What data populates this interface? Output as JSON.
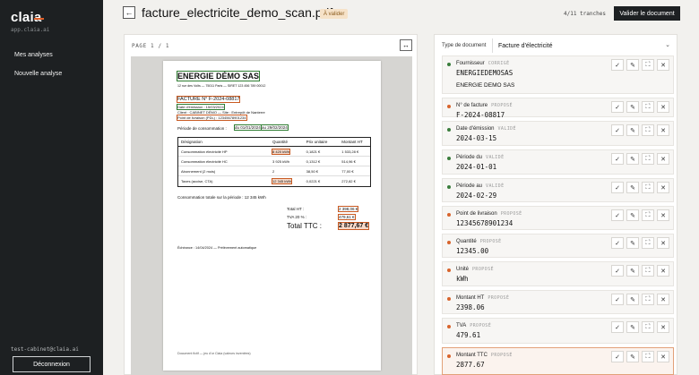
{
  "app": {
    "logo": "claia",
    "domain": "app.claia.ai",
    "accent": "#e2612b"
  },
  "sidebar": {
    "items": [
      {
        "label": "Mes analyses"
      },
      {
        "label": "Nouvelle analyse"
      }
    ],
    "user_email": "test-cabinet@claia.ai",
    "logout_label": "Déconnexion"
  },
  "header": {
    "back_icon": "arrow-left-icon",
    "title": "facture_electricite_demo_scan.pdf",
    "status": "À valider",
    "slice_count": "4/11 tranches",
    "validate_label": "Valider le document"
  },
  "viewer": {
    "page_indicator": "PAGE 1 / 1",
    "expand_icon": "expand-horizontal-icon",
    "pdf": {
      "company": "ENERGIE DÉMO SAS",
      "address": "12 rue des Volts — 75011 Paris — SIRET 123 456 789 00012",
      "invoice_no": "FACTURE N° F-2024-08817",
      "issue_date": "Date d'émission : 15/03/2024",
      "client": "Client : CABINET DÉMO — Site : Entrepôt de Nanterre",
      "delivery_point": "Point de livraison (PDL) : 12345678901234",
      "period_label": "Période de consommation :",
      "period_from": "du 01/01/2024",
      "period_to": "au 29/02/2024",
      "table_headers": [
        "Désignation",
        "Quantité",
        "Prix unitaire",
        "Montant HT"
      ],
      "table_rows": [
        [
          "Consommation électricité HP",
          "8 420 kWh",
          "0,1821 €",
          "1 533,28 €"
        ],
        [
          "Consommation électricité HC",
          "3 925 kWh",
          "0,1312 €",
          "514,96 €"
        ],
        [
          "Abonnement (2 mois)",
          "2",
          "38,50 €",
          "77,00 €"
        ],
        [
          "Taxes (accise, CTA)",
          "12 345 kWh",
          "0,0221 €",
          "272,82 €"
        ]
      ],
      "total_consumption": "Consommation totale sur la période : 12 345 kWh",
      "total_ht_label": "Total HT :",
      "total_ht": "2 398,06 €",
      "tva_label": "TVA 20 % :",
      "tva": "479,61 €",
      "total_ttc_label": "Total TTC :",
      "total_ttc": "2 877,67 €",
      "due": "Échéance : 14/04/2024 — Prélèvement automatique",
      "footer": "Document fictif — jeu d'or Claia (valeurs inventées)"
    }
  },
  "panel": {
    "doc_type_label": "Type de document",
    "doc_type_value": "Facture d'électricité",
    "fields": [
      {
        "name": "Fournisseur",
        "state": "CORRIGÉ",
        "value": "ENERGIEDEMOSAS",
        "value2": "ENERGIE DEMO SAS",
        "color": "#3a7d3c"
      },
      {
        "name": "N° de facture",
        "state": "PROPOSÉ",
        "value": "F-2024-08817",
        "color": "#d8642c"
      },
      {
        "name": "Date d'émission",
        "state": "VALIDÉ",
        "value": "2024-03-15",
        "color": "#3a7d3c"
      },
      {
        "name": "Période du",
        "state": "VALIDÉ",
        "value": "2024-01-01",
        "color": "#3a7d3c"
      },
      {
        "name": "Période au",
        "state": "VALIDÉ",
        "value": "2024-02-29",
        "color": "#3a7d3c"
      },
      {
        "name": "Point de livraison",
        "state": "PROPOSÉ",
        "value": "12345678901234",
        "color": "#d8642c"
      },
      {
        "name": "Quantité",
        "state": "PROPOSÉ",
        "value": "12345.00",
        "color": "#d8642c"
      },
      {
        "name": "Unité",
        "state": "PROPOSÉ",
        "value": "kWh",
        "color": "#d8642c"
      },
      {
        "name": "Montant HT",
        "state": "PROPOSÉ",
        "value": "2398.06",
        "color": "#d8642c"
      },
      {
        "name": "TVA",
        "state": "PROPOSÉ",
        "value": "479.61",
        "color": "#d8642c"
      },
      {
        "name": "Montant TTC",
        "state": "PROPOSÉ",
        "value": "2877.67",
        "color": "#d8642c"
      }
    ],
    "action_icons": [
      "check-icon",
      "pencil-icon",
      "crop-icon",
      "close-icon"
    ]
  }
}
